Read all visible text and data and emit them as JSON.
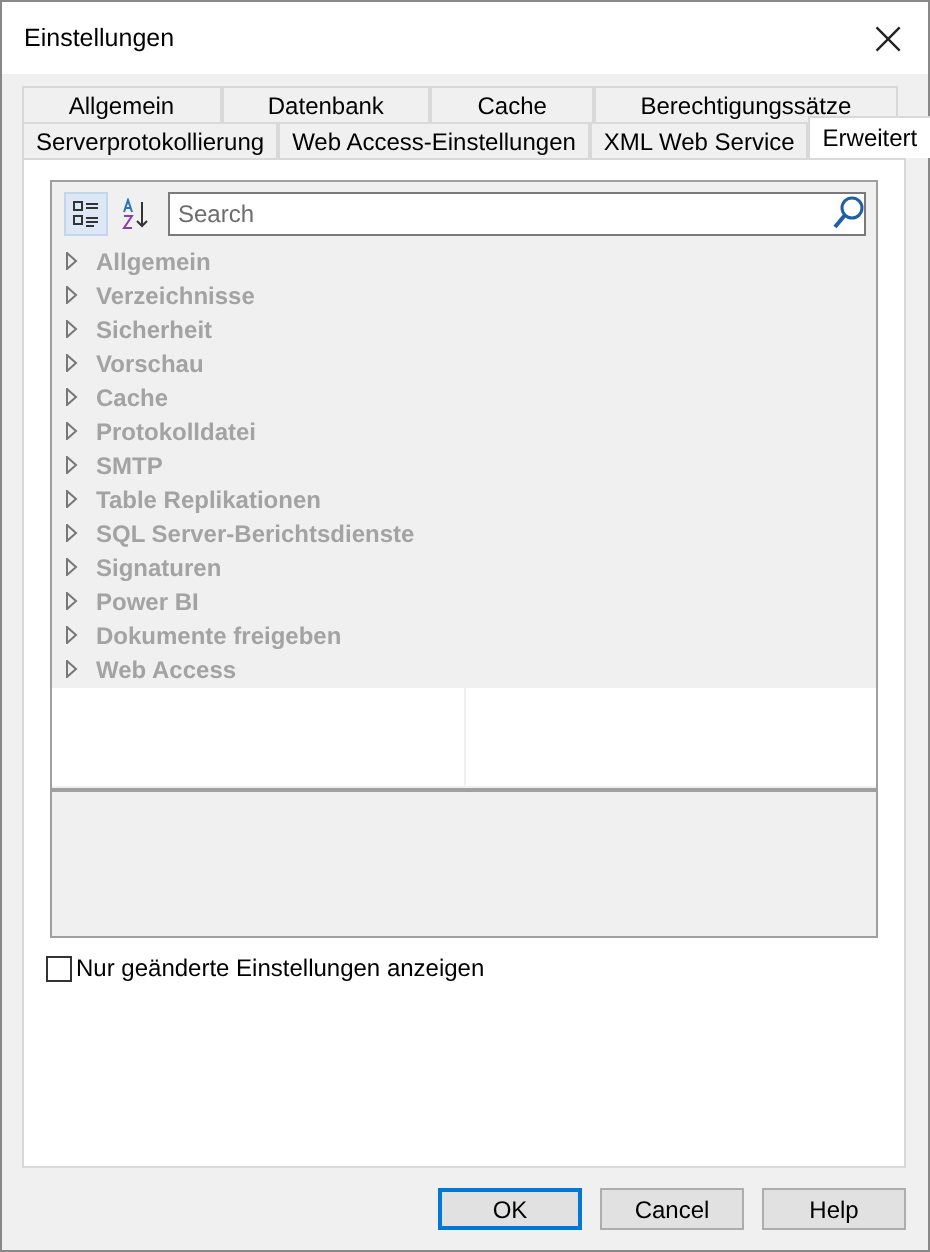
{
  "window": {
    "title": "Einstellungen",
    "close": "×"
  },
  "tab_rows": [
    [
      {
        "label": "Allgemein",
        "selected": false
      },
      {
        "label": "Datenbank",
        "selected": false
      },
      {
        "label": "Cache",
        "selected": false
      },
      {
        "label": "Berechtigungssätze",
        "selected": false
      }
    ],
    [
      {
        "label": "Serverprotokollierung",
        "selected": false
      },
      {
        "label": "Web Access-Einstellungen",
        "selected": false
      },
      {
        "label": "XML Web Service",
        "selected": false
      },
      {
        "label": "Erweitert",
        "selected": true
      }
    ]
  ],
  "toolbar": [
    {
      "kind": "categorized",
      "selected": true
    },
    {
      "kind": "alphabetical",
      "selected": false
    }
  ],
  "search": {
    "placeholder": "Search"
  },
  "categories": [
    {
      "label": "Allgemein",
      "expanded": false
    },
    {
      "label": "Verzeichnisse",
      "expanded": false
    },
    {
      "label": "Sicherheit",
      "expanded": false
    },
    {
      "label": "Vorschau",
      "expanded": false
    },
    {
      "label": "Cache",
      "expanded": false
    },
    {
      "label": "Protokolldatei",
      "expanded": false
    },
    {
      "label": "SMTP",
      "expanded": false
    },
    {
      "label": "Table Replikationen",
      "expanded": false
    },
    {
      "label": "SQL Server-Berichtsdienste",
      "expanded": false
    },
    {
      "label": "Signaturen",
      "expanded": false
    },
    {
      "label": "Power BI",
      "expanded": false
    },
    {
      "label": "Dokumente freigeben",
      "expanded": false
    },
    {
      "label": "Web Access",
      "expanded": false
    }
  ],
  "checkbox": {
    "label": "Nur geänderte Einstellungen anzeigen",
    "checked": false
  },
  "buttons": [
    {
      "label": "OK",
      "default": true
    },
    {
      "label": "Cancel",
      "default": false
    },
    {
      "label": "Help",
      "default": false
    }
  ]
}
